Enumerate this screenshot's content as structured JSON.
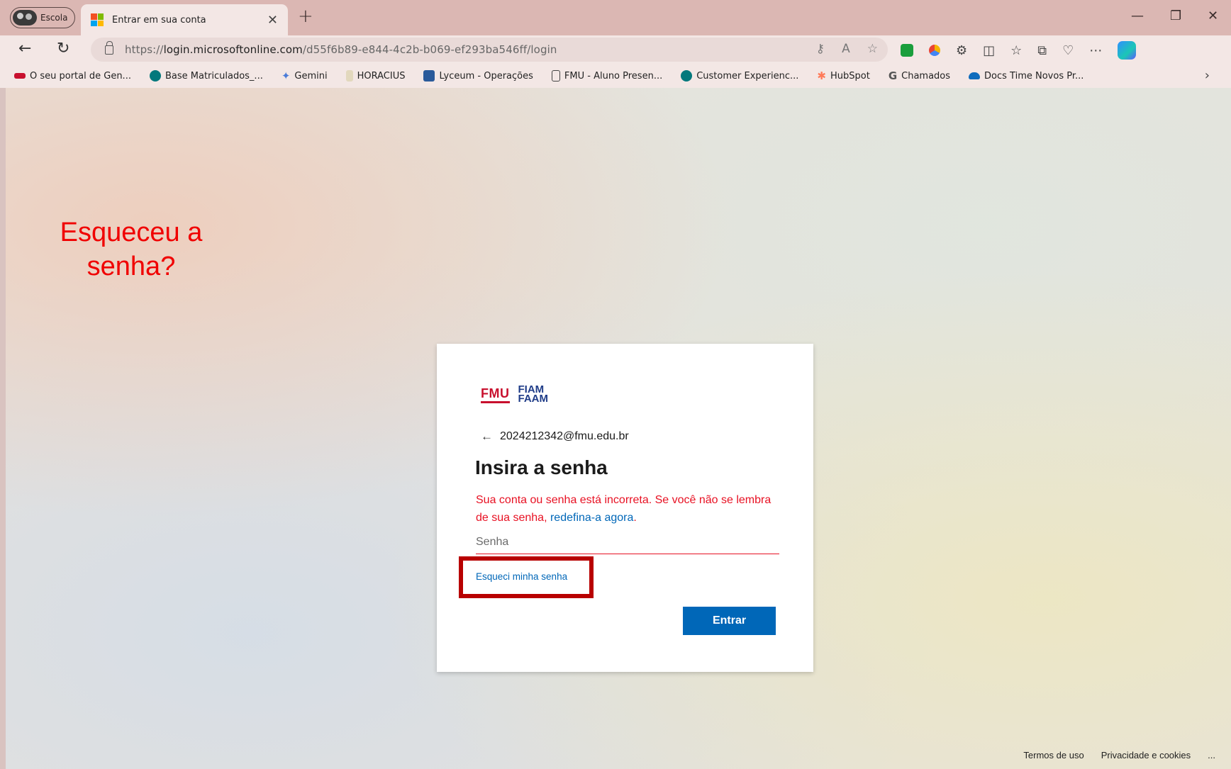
{
  "browser": {
    "profile_label": "Escola",
    "tab_title": "Entrar em sua conta",
    "url_prefix": "https://",
    "url_domain": "login.microsoftonline.com",
    "url_path": "/d55f6b89-e844-4c2b-b069-ef293ba546ff/login"
  },
  "bookmarks": [
    {
      "label": "O seu portal de Gen...",
      "icon": "fmu-icon",
      "color": "#c8102e"
    },
    {
      "label": "Base Matriculados_...",
      "icon": "sharepoint-icon",
      "color": "#03787c"
    },
    {
      "label": "Gemini",
      "icon": "gemini-icon",
      "color": "#4a7bd8"
    },
    {
      "label": "HORACIUS",
      "icon": "horacius-icon",
      "color": "#d9d0b8"
    },
    {
      "label": "Lyceum - Operações",
      "icon": "lyceum-icon",
      "color": "#2a5a9a"
    },
    {
      "label": "FMU - Aluno Presen...",
      "icon": "document-icon",
      "color": "#ffffff"
    },
    {
      "label": "Customer Experienc...",
      "icon": "sharepoint-icon",
      "color": "#03787c"
    },
    {
      "label": "HubSpot",
      "icon": "hubspot-icon",
      "color": "#ff7a59"
    },
    {
      "label": "Chamados",
      "icon": "chamados-icon",
      "color": "#555555"
    },
    {
      "label": "Docs Time Novos Pr...",
      "icon": "onedrive-icon",
      "color": "#0f6cbd"
    }
  ],
  "annotation": {
    "line1": "Esqueceu a",
    "line2": "senha?"
  },
  "login": {
    "logo_left": "FMU",
    "logo_right_top": "FIAM",
    "logo_right_bottom": "FAAM",
    "account": "2024212342@fmu.edu.br",
    "title": "Insira a senha",
    "error_text": "Sua conta ou senha está incorreta. Se você não se lembra de sua senha, ",
    "error_link": "redefina-a agora",
    "error_end": ".",
    "password_placeholder": "Senha",
    "forgot_link": "Esqueci minha senha",
    "submit_label": "Entrar"
  },
  "footer": {
    "terms": "Termos de uso",
    "privacy": "Privacidade e cookies",
    "more": "..."
  },
  "colors": {
    "accent": "#0067b8",
    "error": "#e81123",
    "annotation": "#f00000",
    "highlight": "#b80000"
  }
}
